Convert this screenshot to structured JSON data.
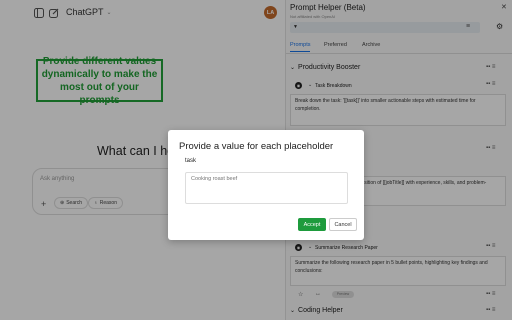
{
  "chat": {
    "title": "ChatGPT",
    "avatar_initials": "LA",
    "heading": "What can I help with?",
    "input_placeholder": "Ask anything",
    "search_label": "Search",
    "reason_label": "Reason",
    "icons": [
      "sidebar-toggle-icon",
      "new-chat-icon",
      "chevron-down-icon",
      "plus-icon",
      "globe-icon",
      "bulb-icon"
    ]
  },
  "promo": {
    "text": "Provide different values dynamically to make the most out of your prompts",
    "color": "#23a23a"
  },
  "panel": {
    "title": "Prompt Helper (Beta)",
    "subtitle": "Not affiliated with OpenAI",
    "tabs": [
      "Prompts",
      "Preferred",
      "Archive"
    ],
    "active_tab": "Prompts",
    "categories": [
      {
        "name": "Productivity Booster",
        "items": [
          {
            "name": "Task Breakdown",
            "text": "Break down the task: '[[task]]' into smaller actionable steps with estimated time for completion."
          },
          {
            "name": "",
            "text": "Conduct an interview for the position of [[jobTitle]] with experience, skills, and problem-solving abilities."
          },
          {
            "name": "Summarize Research Paper",
            "text": "Summarize the following research paper in 5 bullet points, highlighting key findings and conclusions:"
          }
        ]
      },
      {
        "name": "Coding Helper",
        "items": []
      }
    ],
    "toggle_label": "Preview"
  },
  "modal": {
    "title": "Provide a value for each placeholder",
    "field_label": "task",
    "field_placeholder": "Cooking roast beef",
    "accept_label": "Accept",
    "cancel_label": "Cancel",
    "accent_color": "#1e9b3d"
  }
}
